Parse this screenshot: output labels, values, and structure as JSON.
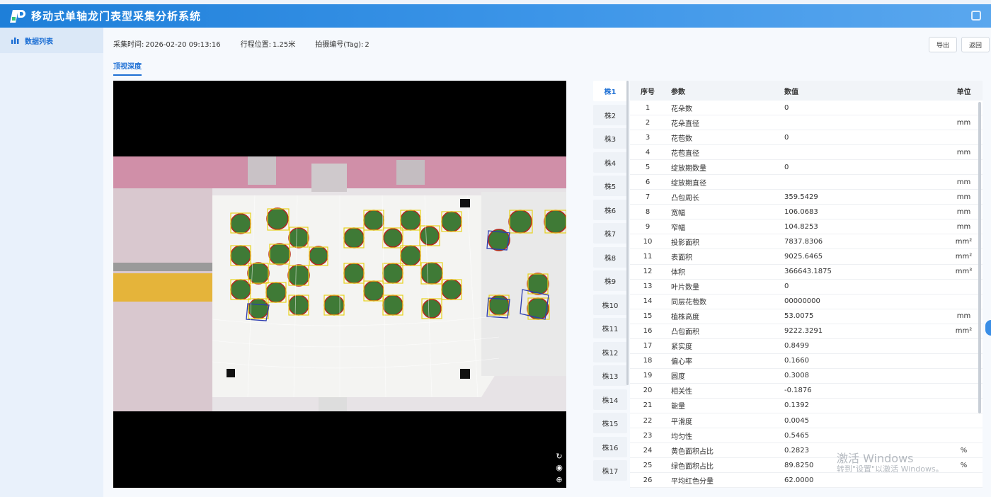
{
  "app": {
    "title": "移动式单轴龙门表型采集分析系统"
  },
  "sidebar": {
    "items": [
      {
        "label": "数据列表"
      }
    ]
  },
  "info": {
    "time_label": "采集时间:",
    "time_value": "2026-02-20 09:13:16",
    "pos_label": "行程位置:",
    "pos_value": "1.25米",
    "tag_label": "拍摄编号(Tag):",
    "tag_value": "2"
  },
  "buttons": {
    "export": "导出",
    "back": "返回"
  },
  "view_tab": "顶视深度",
  "plant_tabs": [
    "株1",
    "株2",
    "株3",
    "株4",
    "株5",
    "株6",
    "株7",
    "株8",
    "株9",
    "株10",
    "株11",
    "株12",
    "株13",
    "株14",
    "株15",
    "株16",
    "株17"
  ],
  "table": {
    "headers": {
      "idx": "序号",
      "param": "参数",
      "value": "数值",
      "unit": "单位"
    },
    "rows": [
      {
        "idx": "1",
        "param": "花朵数",
        "value": "0",
        "unit": ""
      },
      {
        "idx": "2",
        "param": "花朵直径",
        "value": "",
        "unit": "mm"
      },
      {
        "idx": "3",
        "param": "花苞数",
        "value": "0",
        "unit": ""
      },
      {
        "idx": "4",
        "param": "花苞直径",
        "value": "",
        "unit": "mm"
      },
      {
        "idx": "5",
        "param": "绽放期数量",
        "value": "0",
        "unit": ""
      },
      {
        "idx": "6",
        "param": "绽放期直径",
        "value": "",
        "unit": "mm"
      },
      {
        "idx": "7",
        "param": "凸包周长",
        "value": "359.5429",
        "unit": "mm"
      },
      {
        "idx": "8",
        "param": "宽幅",
        "value": "106.0683",
        "unit": "mm"
      },
      {
        "idx": "9",
        "param": "窄幅",
        "value": "104.8253",
        "unit": "mm"
      },
      {
        "idx": "10",
        "param": "投影面积",
        "value": "7837.8306",
        "unit": "mm²"
      },
      {
        "idx": "11",
        "param": "表面积",
        "value": "9025.6465",
        "unit": "mm²"
      },
      {
        "idx": "12",
        "param": "体积",
        "value": "366643.1875",
        "unit": "mm³"
      },
      {
        "idx": "13",
        "param": "叶片数量",
        "value": "0",
        "unit": ""
      },
      {
        "idx": "14",
        "param": "同层花苞数",
        "value": "00000000",
        "unit": ""
      },
      {
        "idx": "15",
        "param": "植株高度",
        "value": "53.0075",
        "unit": "mm"
      },
      {
        "idx": "16",
        "param": "凸包面积",
        "value": "9222.3291",
        "unit": "mm²"
      },
      {
        "idx": "17",
        "param": "紧实度",
        "value": "0.8499",
        "unit": ""
      },
      {
        "idx": "18",
        "param": "偏心率",
        "value": "0.1660",
        "unit": ""
      },
      {
        "idx": "19",
        "param": "圆度",
        "value": "0.3008",
        "unit": ""
      },
      {
        "idx": "20",
        "param": "相关性",
        "value": "-0.1876",
        "unit": ""
      },
      {
        "idx": "21",
        "param": "能量",
        "value": "0.1392",
        "unit": ""
      },
      {
        "idx": "22",
        "param": "平滑度",
        "value": "0.0045",
        "unit": ""
      },
      {
        "idx": "23",
        "param": "均匀性",
        "value": "0.5465",
        "unit": ""
      },
      {
        "idx": "24",
        "param": "黄色面积占比",
        "value": "0.2823",
        "unit": "%"
      },
      {
        "idx": "25",
        "param": "绿色面积占比",
        "value": "89.8250",
        "unit": "%"
      },
      {
        "idx": "26",
        "param": "平均红色分量",
        "value": "62.0000",
        "unit": ""
      }
    ]
  },
  "watermark": {
    "line1": "激活 Windows",
    "line2": "转到\"设置\"以激活 Windows。"
  }
}
